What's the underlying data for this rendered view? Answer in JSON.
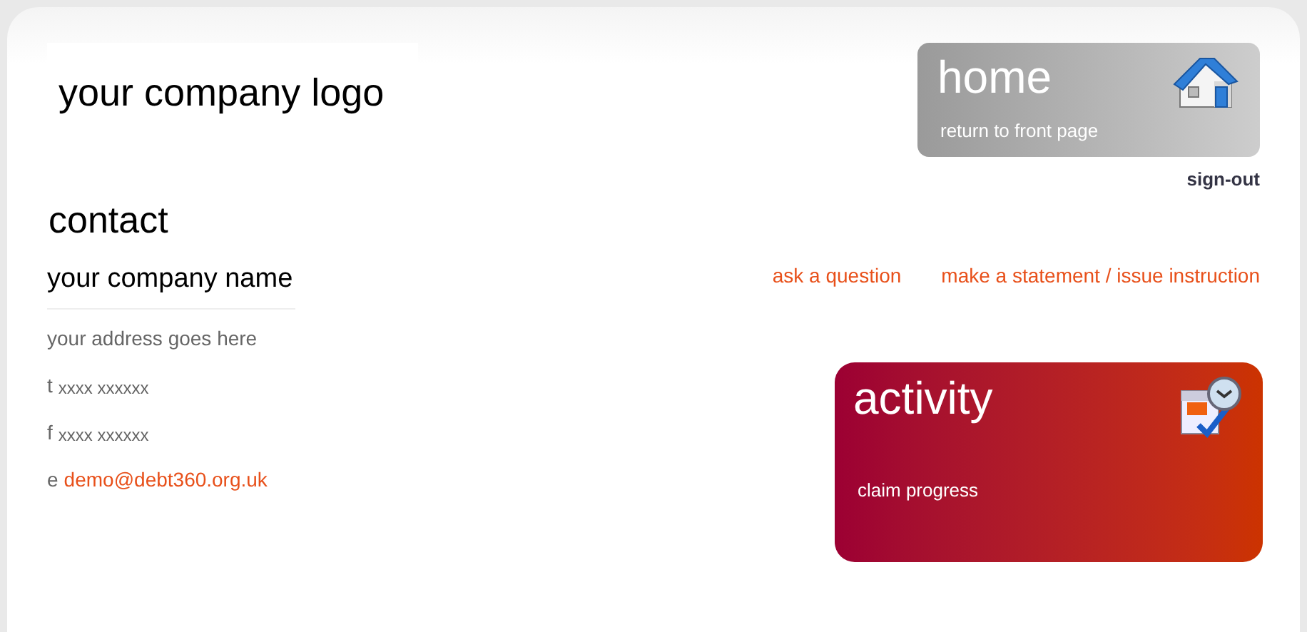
{
  "logo": "your company logo",
  "home_tile": {
    "title": "home",
    "subtitle": "return to front page"
  },
  "sign_out": "sign-out",
  "heading": "contact",
  "company_name": "your company name",
  "actions": [
    "ask a question",
    "make a statement / issue instruction"
  ],
  "address": "your address goes here",
  "contact_lines": [
    {
      "label": "t",
      "value": "xxxx xxxxxx",
      "kind": "text"
    },
    {
      "label": "f",
      "value": "xxxx xxxxxx",
      "kind": "text"
    },
    {
      "label": "e",
      "value": "demo@debt360.org.uk",
      "kind": "link"
    }
  ],
  "activity_tile": {
    "title": "activity",
    "subtitle": "claim progress"
  }
}
